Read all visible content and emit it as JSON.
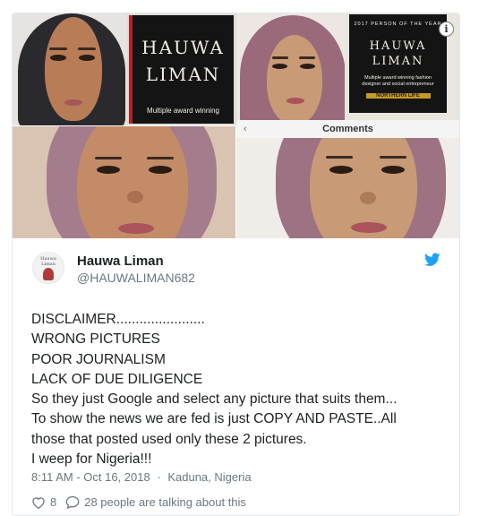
{
  "photo_card": {
    "book_left": {
      "line1": "HAUWA",
      "line2": "LIMAN",
      "caption": "Multiple award winning"
    },
    "book_right": {
      "header": "2017 PERSON OF THE YEAR",
      "line1": "HAUWA",
      "line2": "LIMAN",
      "caption": "Multiple award winning fashion designer and social entrepreneur",
      "badge": "NORTHERN LIFE"
    },
    "comments_label": "Comments",
    "info_icon": "i"
  },
  "tweet": {
    "avatar_text": "Hauwa Liman",
    "name": "Hauwa Liman",
    "handle": "@HAUWALIMAN682",
    "lines": [
      "DISCLAIMER.......................",
      "WRONG PICTURES",
      "POOR JOURNALISM",
      "LACK OF DUE DILIGENCE",
      "So they just Google and select any picture that suits them...",
      "To show the news we are fed is just COPY AND PASTE..All",
      "those that posted used only these 2 pictures.",
      "I weep for Nigeria!!!"
    ],
    "time": "8:11 AM - Oct 16, 2018",
    "separator": "·",
    "location": "Kaduna, Nigeria",
    "likes": "8",
    "conversation": "28 people are talking about this"
  },
  "colors": {
    "twitter_blue": "#1da1f2",
    "text": "#1c2022",
    "muted": "#697882"
  }
}
